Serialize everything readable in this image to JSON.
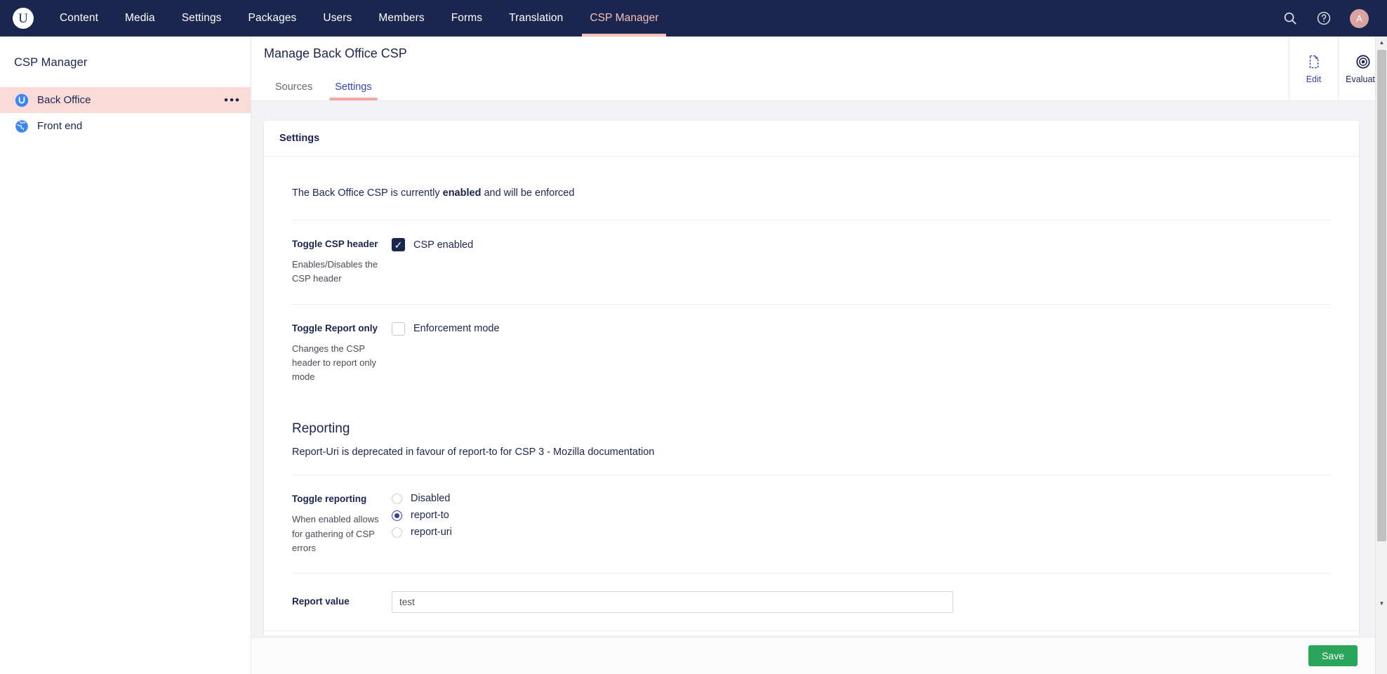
{
  "topnav": {
    "logo_letter": "U",
    "items": [
      {
        "label": "Content",
        "active": false
      },
      {
        "label": "Media",
        "active": false
      },
      {
        "label": "Settings",
        "active": false
      },
      {
        "label": "Packages",
        "active": false
      },
      {
        "label": "Users",
        "active": false
      },
      {
        "label": "Members",
        "active": false
      },
      {
        "label": "Forms",
        "active": false
      },
      {
        "label": "Translation",
        "active": false
      },
      {
        "label": "CSP Manager",
        "active": true
      }
    ],
    "search_icon": "search-icon",
    "help_icon": "help-icon",
    "avatar_initial": "A",
    "background": "#1b264f",
    "active_color": "#f5c0b8"
  },
  "sidebar": {
    "title": "CSP Manager",
    "items": [
      {
        "label": "Back Office",
        "icon": "umbraco-logo-icon",
        "selected": true,
        "menu": "•••"
      },
      {
        "label": "Front end",
        "icon": "globe-icon",
        "selected": false,
        "menu": ""
      }
    ],
    "selected_background": "#fbdbd7"
  },
  "header": {
    "title": "Manage Back Office CSP",
    "actions": [
      {
        "label": "Edit",
        "icon": "document-dashed-icon",
        "active": true
      },
      {
        "label": "Evaluate",
        "icon": "target-icon",
        "active": false
      }
    ],
    "tabs": [
      {
        "label": "Sources",
        "active": false
      },
      {
        "label": "Settings",
        "active": true
      }
    ],
    "tab_accent": "#f5aaa0"
  },
  "settings_card": {
    "heading": "Settings",
    "status": {
      "prefix": "The Back Office CSP is currently ",
      "emphasis": "enabled",
      "suffix": " and will be enforced"
    },
    "rows": [
      {
        "name": "Toggle CSP header",
        "description": "Enables/Disables the CSP header",
        "control": "checkbox",
        "checkbox_label": "CSP enabled",
        "checked": true
      },
      {
        "name": "Toggle Report only",
        "description": "Changes the CSP header to report only mode",
        "control": "checkbox",
        "checkbox_label": "Enforcement mode",
        "checked": false
      }
    ],
    "reporting": {
      "title": "Reporting",
      "subtitle": "Report-Uri is deprecated in favour of report-to for CSP 3 - Mozilla documentation",
      "row_name": "Toggle reporting",
      "row_description": "When enabled allows for gathering of CSP errors",
      "options": [
        {
          "label": "Disabled",
          "selected": false
        },
        {
          "label": "report-to",
          "selected": true
        },
        {
          "label": "report-uri",
          "selected": false
        }
      ]
    },
    "report_value": {
      "name": "Report value",
      "value": "test",
      "placeholder": ""
    }
  },
  "footer": {
    "save_label": "Save",
    "save_color": "#2ba55c"
  }
}
